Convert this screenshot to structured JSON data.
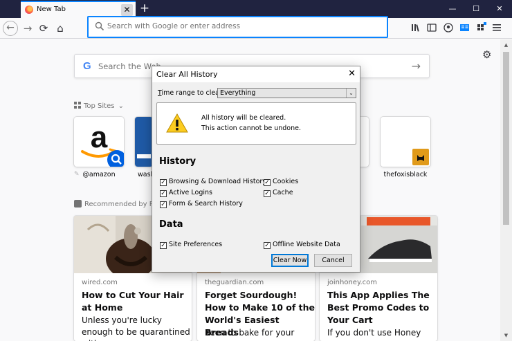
{
  "browser": {
    "tab_title": "New Tab",
    "tab_close": "✕",
    "new_tab": "+",
    "window_controls": {
      "minimize": "—",
      "maximize": "☐",
      "close": "✕"
    },
    "url_placeholder": "Search with Google or enter address",
    "nav_icons": {
      "back": "←",
      "forward": "→",
      "reload": "⟳",
      "home": "⌂"
    },
    "toolbar_icons": [
      "library-icon",
      "sidebar-icon",
      "account-icon",
      "reader-icon",
      "extensions-icon",
      "menu-icon"
    ],
    "accent_color": "#0a84ff"
  },
  "newtab": {
    "search_placeholder": "Search the Web",
    "google_letter": "G",
    "search_arrow": "→",
    "settings_icon": "⚙",
    "top_sites_heading": "Top Sites",
    "top_sites_chevron": "⌄",
    "top_sites": [
      {
        "label": "@amazon",
        "icon": "amazon-logo"
      },
      {
        "label": "wash",
        "icon": "washingtonpost-screenshot"
      },
      {
        "label": "thefoxisblack",
        "icon": "fox-logo"
      }
    ],
    "pin_icon": "✎",
    "recommended_heading": "Recommended by Po",
    "cards": [
      {
        "source": "wired.com",
        "title": "How to Cut Your Hair at Home",
        "excerpt": "Unless you're lucky enough to be quarantined with a"
      },
      {
        "source": "theguardian.com",
        "title": "Forget Sourdough! How to Make 10 of the World's Easiest Breads",
        "excerpt": "Keen to bake for your"
      },
      {
        "source": "joinhoney.com",
        "title": "This App Applies The Best Promo Codes to Your Cart",
        "excerpt": "If you don't use Honey"
      }
    ]
  },
  "dialog": {
    "title": "Clear All History",
    "close": "✕",
    "time_range_label": "Time range to clear:",
    "time_range_value": "Everything",
    "time_range_arrow": "⌄",
    "warning_line1": "All history will be cleared.",
    "warning_line2": "This action cannot be undone.",
    "warning_icon": "!",
    "history_heading": "History",
    "history_items": [
      {
        "label": "Browsing & Download History",
        "checked": true
      },
      {
        "label": "Cookies",
        "checked": true
      },
      {
        "label": "Active Logins",
        "checked": true
      },
      {
        "label": "Cache",
        "checked": true
      },
      {
        "label": "Form & Search History",
        "checked": true
      }
    ],
    "data_heading": "Data",
    "data_items": [
      {
        "label": "Site Preferences",
        "checked": true
      },
      {
        "label": "Offline Website Data",
        "checked": true
      }
    ],
    "check_mark": "✓",
    "clear_now_label": "Clear Now",
    "cancel_label": "Cancel"
  }
}
